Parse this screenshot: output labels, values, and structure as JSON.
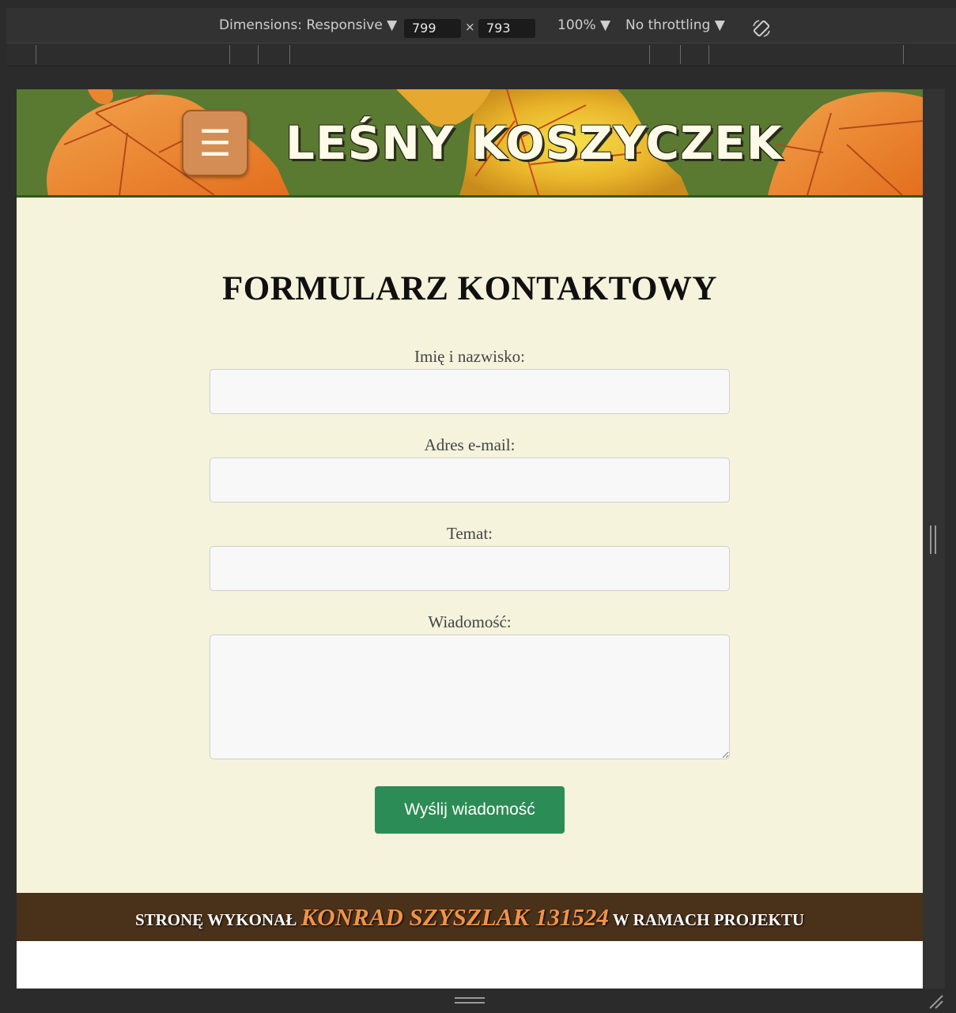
{
  "devtools": {
    "dimensions_label": "Dimensions: Responsive ▼",
    "width_value": "799",
    "times": "×",
    "height_value": "793",
    "zoom_label": "100% ▼",
    "throttling_label": "No throttling ▼"
  },
  "header": {
    "menu_glyph": "☰",
    "logo_text": "LEŚNY KOSZYCZEK"
  },
  "form": {
    "title": "FORMULARZ KONTAKTOWY",
    "name_label": "Imię i nazwisko:",
    "email_label": "Adres e-mail:",
    "subject_label": "Temat:",
    "message_label": "Wiadomość:",
    "name_value": "",
    "email_value": "",
    "subject_value": "",
    "message_value": "",
    "submit_label": "Wyślij wiadomość"
  },
  "footer": {
    "prefix": "STRONĘ WYKONAŁ ",
    "author": "KONRAD SZYSZLAK 131524",
    "suffix": " W RAMACH PROJEKTU"
  },
  "colors": {
    "page_bg": "#f5f3dc",
    "header_green": "#5a7a32",
    "button_green": "#2c8c55",
    "footer_brown": "#4a3119",
    "author_orange": "#f0934a",
    "menu_orange": "#d48e55"
  },
  "icons": {
    "rotate": "rotate-device-icon",
    "menu": "hamburger-menu-icon"
  }
}
